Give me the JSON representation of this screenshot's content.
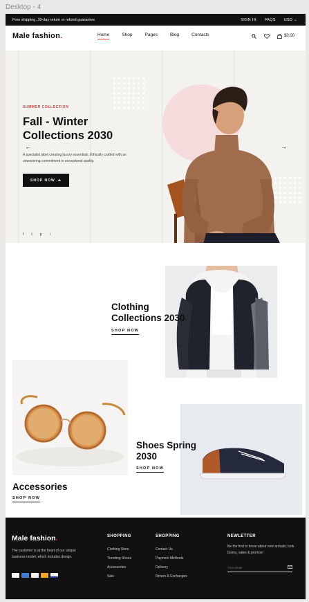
{
  "canvas": {
    "label": "Desktop - 4"
  },
  "topbar": {
    "message": "Free shipping, 30-day return or refund guarantee.",
    "links": [
      "SIGN IN",
      "FAQS",
      "USD ⌄"
    ]
  },
  "header": {
    "logo": "Male fashion",
    "logo_dot": ".",
    "nav": [
      "Home",
      "Shop",
      "Pages",
      "Blog",
      "Contacts"
    ],
    "cart_total": "$0.00",
    "icons": [
      "search-icon",
      "heart-icon",
      "bag-icon"
    ]
  },
  "hero": {
    "subtitle": "SUMMER COLLECTION",
    "title": "Fall - Winter Collections 2030",
    "description": "A specialist label creating luxury essentials. Ethically crafted with an unwavering commitment to exceptional quality.",
    "button": "SHOP NOW",
    "prev_icon": "←",
    "next_icon": "→",
    "socials": [
      "f",
      "t",
      "p",
      "i"
    ]
  },
  "collections": [
    {
      "title": "Clothing Collections 2030",
      "link": "SHOP NOW"
    },
    {
      "title": "Accessories",
      "link": "SHOP NOW"
    },
    {
      "title": "Shoes Spring 2030",
      "link": "SHOP NOW"
    }
  ],
  "footer": {
    "logo": "Male fashion",
    "logo_dot": ".",
    "description": "The customer is at the heart of our unique business model, which includes design.",
    "shopping_1": {
      "title": "SHOPPING",
      "items": [
        "Clothing Store",
        "Trending Shoes",
        "Accessories",
        "Sale"
      ]
    },
    "shopping_2": {
      "title": "SHOPPING",
      "items": [
        "Contact Us",
        "Payment Methods",
        "Delivery",
        "Return & Exchanges"
      ]
    },
    "newsletter": {
      "title": "NEWLETTER",
      "description": "Be the first to know about new arrivals, look books, sales & promos!",
      "placeholder": "Your email"
    },
    "payment_cards": [
      "Discover",
      "Amex",
      "Maestro",
      "Mastercard",
      "VISA"
    ]
  },
  "colors": {
    "accent": "#e53637",
    "dark": "#111111",
    "hero_bg": "#f3f2ee",
    "circle": "#f6dbdd"
  }
}
